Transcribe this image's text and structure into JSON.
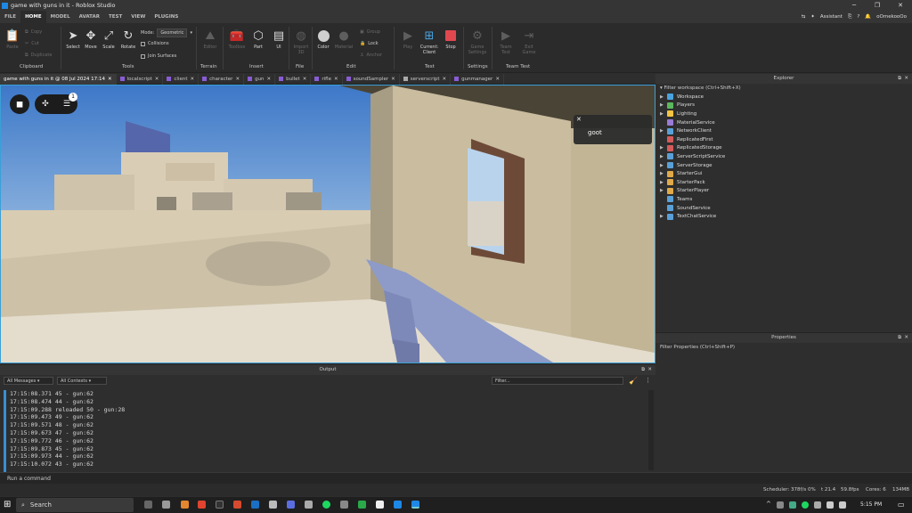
{
  "window": {
    "title": "game with guns in it - Roblox Studio"
  },
  "menubar": {
    "tabs": [
      "FILE",
      "HOME",
      "MODEL",
      "AVATAR",
      "TEST",
      "VIEW",
      "PLUGINS"
    ],
    "active_tab": "HOME",
    "assistant_label": "Assistant",
    "username": "oOmekooOo"
  },
  "ribbon": {
    "clipboard": {
      "paste": "Paste",
      "copy": "Copy",
      "cut": "Cut",
      "duplicate": "Duplicate",
      "label": "Clipboard"
    },
    "tools": {
      "select": "Select",
      "move": "Move",
      "scale": "Scale",
      "rotate": "Rotate",
      "mode_label": "Mode:",
      "mode_value": "Geometric",
      "collisions": "Collisions",
      "join_surfaces": "Join Surfaces",
      "label": "Tools"
    },
    "terrain": {
      "editor": "Editor",
      "label": "Terrain"
    },
    "insert": {
      "toolbox": "Toolbox",
      "part": "Part",
      "ui": "UI",
      "label": "Insert"
    },
    "file": {
      "import3d": "Import 3D",
      "label": "File"
    },
    "edit": {
      "color": "Color",
      "material": "Material",
      "group": "Group",
      "lock": "Lock",
      "anchor": "Anchor",
      "label": "Edit"
    },
    "test": {
      "play": "Play",
      "current_client": "Current: Client",
      "stop": "Stop",
      "label": "Test"
    },
    "settings": {
      "game_settings": "Game Settings",
      "label": "Settings"
    },
    "team_test": {
      "team_test": "Team Test",
      "exit_game": "Exit Game",
      "label": "Team Test"
    }
  },
  "doc_tabs": [
    "game with guns in it @ 08 Jul 2024 17:14",
    "localscript",
    "client",
    "character",
    "gun",
    "bullet",
    "rifle",
    "soundSampler",
    "serverscript",
    "gunmanager"
  ],
  "viewport": {
    "chat_message": "goot",
    "notification_count": "1"
  },
  "explorer": {
    "title": "Explorer",
    "filter_placeholder": "Filter workspace (Ctrl+Shift+X)",
    "items": [
      {
        "label": "Workspace",
        "color": "#4aa3e0",
        "expandable": true
      },
      {
        "label": "Players",
        "color": "#5cb85c",
        "expandable": true
      },
      {
        "label": "Lighting",
        "color": "#f5c542",
        "expandable": true
      },
      {
        "label": "MaterialService",
        "color": "#9a7bd6",
        "expandable": false
      },
      {
        "label": "NetworkClient",
        "color": "#5aa0d8",
        "expandable": true
      },
      {
        "label": "ReplicatedFirst",
        "color": "#d45b5b",
        "expandable": false
      },
      {
        "label": "ReplicatedStorage",
        "color": "#d45b5b",
        "expandable": true
      },
      {
        "label": "ServerScriptService",
        "color": "#5aa0d8",
        "expandable": true
      },
      {
        "label": "ServerStorage",
        "color": "#5aa0d8",
        "expandable": true
      },
      {
        "label": "StarterGui",
        "color": "#e0a94a",
        "expandable": true
      },
      {
        "label": "StarterPack",
        "color": "#e0a94a",
        "expandable": true
      },
      {
        "label": "StarterPlayer",
        "color": "#e0a94a",
        "expandable": true
      },
      {
        "label": "Teams",
        "color": "#5aa0d8",
        "expandable": false
      },
      {
        "label": "SoundService",
        "color": "#5aa0d8",
        "expandable": false
      },
      {
        "label": "TextChatService",
        "color": "#5aa0d8",
        "expandable": true
      }
    ]
  },
  "properties": {
    "title": "Properties",
    "filter_placeholder": "Filter Properties (Ctrl+Shift+P)"
  },
  "output": {
    "title": "Output",
    "messages_filter": "All Messages",
    "contexts_filter": "All Contexts",
    "filter_placeholder": "Filter...",
    "lines": [
      "17:15:08.371  45 - gun:62",
      "17:15:08.474  44 - gun:62",
      "17:15:09.288  reloaded 50 - gun:28",
      "17:15:09.473  49 - gun:62",
      "17:15:09.571  48 - gun:62",
      "17:15:09.673  47 - gun:62",
      "17:15:09.772  46 - gun:62",
      "17:15:09.873  45 - gun:62",
      "17:15:09.973  44 - gun:62",
      "17:15:10.072  43 - gun:62"
    ]
  },
  "command_bar": {
    "placeholder": "Run a command"
  },
  "status_bar": {
    "scheduler": "Scheduler: 378f/s 0%",
    "t": "t 21.4",
    "fps": "59.8fps",
    "cores": "Cores: 6",
    "mem": "134MB"
  },
  "taskbar": {
    "search_label": "Search",
    "time": "5:15 PM"
  }
}
